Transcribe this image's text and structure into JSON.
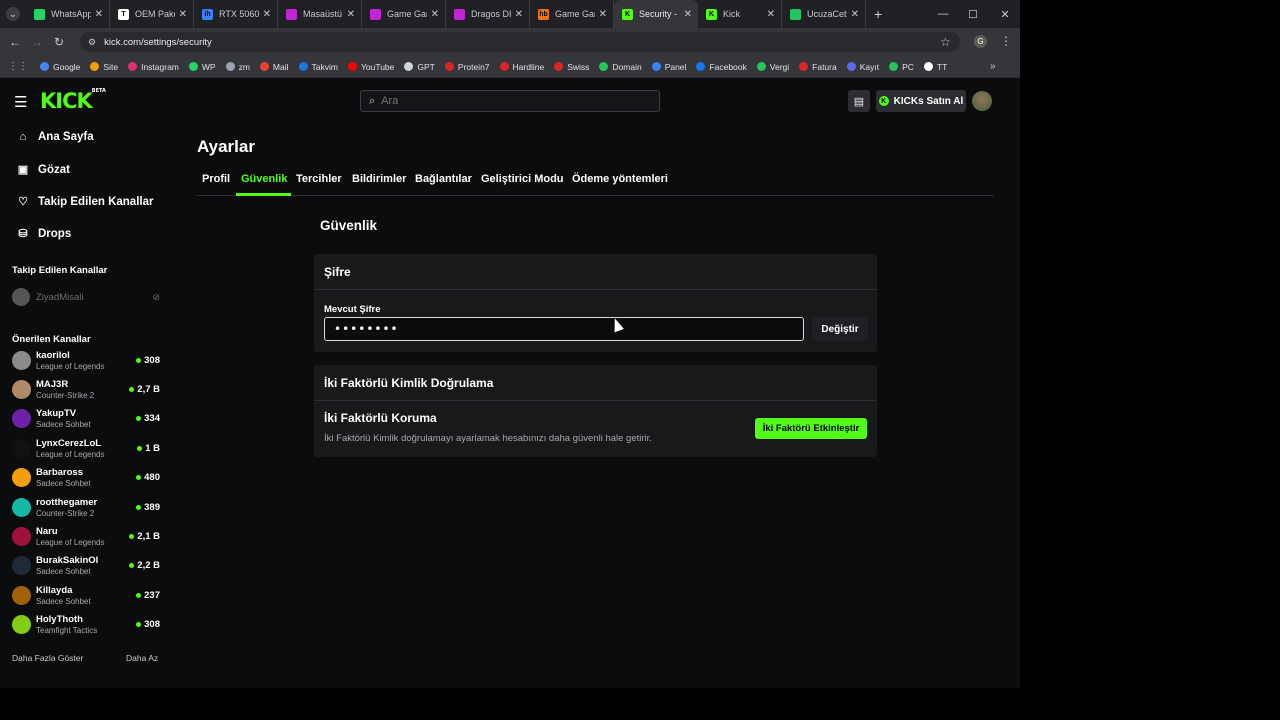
{
  "browser": {
    "tabs": [
      {
        "title": "WhatsApp",
        "color": "#25d366",
        "glyph": "",
        "active": false
      },
      {
        "title": "OEM Paket",
        "color": "#ffffff",
        "glyph": "T",
        "active": false
      },
      {
        "title": "RTX 5060",
        "color": "#3b82f6",
        "glyph": "ih",
        "active": false
      },
      {
        "title": "Masaüstü",
        "color": "#c026d3",
        "glyph": "",
        "active": false
      },
      {
        "title": "Game Gam",
        "color": "#c026d3",
        "glyph": "",
        "active": false
      },
      {
        "title": "Dragos DI",
        "color": "#c026d3",
        "glyph": "",
        "active": false
      },
      {
        "title": "Game Gam",
        "color": "#f97316",
        "glyph": "hb",
        "active": false
      },
      {
        "title": "Security -",
        "color": "#53fc18",
        "glyph": "K",
        "active": true
      },
      {
        "title": "Kick",
        "color": "#53fc18",
        "glyph": "K",
        "active": false
      },
      {
        "title": "UcuzaCeb",
        "color": "#22c55e",
        "glyph": "",
        "active": false
      }
    ],
    "url": "kick.com/settings/security",
    "profile_initial": "G",
    "bookmarks": [
      {
        "label": "Google",
        "color": "#4285f4"
      },
      {
        "label": "Site",
        "color": "#f59e0b"
      },
      {
        "label": "Instagram",
        "color": "#e1306c"
      },
      {
        "label": "WP",
        "color": "#25d366"
      },
      {
        "label": "zm",
        "color": "#9ca3af"
      },
      {
        "label": "Mail",
        "color": "#ea4335"
      },
      {
        "label": "Takvim",
        "color": "#1a73e8"
      },
      {
        "label": "YouTube",
        "color": "#ff0000"
      },
      {
        "label": "GPT",
        "color": "#d1d5db"
      },
      {
        "label": "Protein7",
        "color": "#dc2626"
      },
      {
        "label": "Hardline",
        "color": "#dc2626"
      },
      {
        "label": "Swiss",
        "color": "#dc2626"
      },
      {
        "label": "Domain",
        "color": "#22c55e"
      },
      {
        "label": "Panel",
        "color": "#3b82f6"
      },
      {
        "label": "Facebook",
        "color": "#1877f2"
      },
      {
        "label": "Vergi",
        "color": "#22c55e"
      },
      {
        "label": "Fatura",
        "color": "#dc2626"
      },
      {
        "label": "Kayıt",
        "color": "#6366f1"
      },
      {
        "label": "PC",
        "color": "#22c55e"
      },
      {
        "label": "TT",
        "color": "#ffffff"
      }
    ]
  },
  "header": {
    "logo": "KICK",
    "logo_badge": "BETA",
    "search_placeholder": "Ara",
    "kicks_label": "KICKs Satın Al"
  },
  "sidebar": {
    "nav": [
      {
        "label": "Ana Sayfa",
        "icon": "home-icon"
      },
      {
        "label": "Gözat",
        "icon": "browse-icon"
      },
      {
        "label": "Takip Edilen Kanallar",
        "icon": "heart-icon"
      },
      {
        "label": "Drops",
        "icon": "drops-icon"
      }
    ],
    "followed_title": "Takip Edilen Kanallar",
    "followed": [
      {
        "name": "ZiyadMisali"
      }
    ],
    "recommended_title": "Önerilen Kanallar",
    "recommended": [
      {
        "name": "kaorilol",
        "category": "League of Legends",
        "viewers": "308",
        "color": "#8b8b8b"
      },
      {
        "name": "MAJ3R",
        "category": "Counter-Strike 2",
        "viewers": "2,7 B",
        "color": "#b08968"
      },
      {
        "name": "YakupTV",
        "category": "Sadece Sohbet",
        "viewers": "334",
        "color": "#6b21a8"
      },
      {
        "name": "LynxCerezLoL",
        "category": "League of Legends",
        "viewers": "1 B",
        "color": "#111111"
      },
      {
        "name": "Barbaross",
        "category": "Sadece Sohbet",
        "viewers": "480",
        "color": "#f59e0b"
      },
      {
        "name": "rootthegamer",
        "category": "Counter-Strike 2",
        "viewers": "389",
        "color": "#14b8a6"
      },
      {
        "name": "Naru",
        "category": "League of Legends",
        "viewers": "2,1 B",
        "color": "#9f1239"
      },
      {
        "name": "BurakSakinOl",
        "category": "Sadece Sohbet",
        "viewers": "2,2 B",
        "color": "#1f2937"
      },
      {
        "name": "Killayda",
        "category": "Sadece Sohbet",
        "viewers": "237",
        "color": "#a16207"
      },
      {
        "name": "HolyThoth",
        "category": "Teamfight Tactics",
        "viewers": "308",
        "color": "#84cc16"
      }
    ],
    "show_more": "Daha Fazla Göster",
    "show_less": "Daha Az"
  },
  "page": {
    "title": "Ayarlar",
    "tabs": [
      "Profil",
      "Güvenlik",
      "Tercihler",
      "Bildirimler",
      "Bağlantılar",
      "Geliştirici Modu",
      "Ödeme yöntemleri"
    ],
    "active_tab": "Güvenlik",
    "section_title": "Güvenlik",
    "password": {
      "card_title": "Şifre",
      "field_label": "Mevcut Şifre",
      "value": "••••••••",
      "change_button": "Değiştir"
    },
    "twofa": {
      "card_title": "İki Faktörlü Kimlik Doğrulama",
      "title": "İki Faktörlü Koruma",
      "description": "İki Faktörlü Kimlik doğrulamayı ayarlamak hesabınızı daha güvenli hale getirir.",
      "button": "İki Faktörü Etkinleştir"
    }
  },
  "accent": "#53fc18"
}
